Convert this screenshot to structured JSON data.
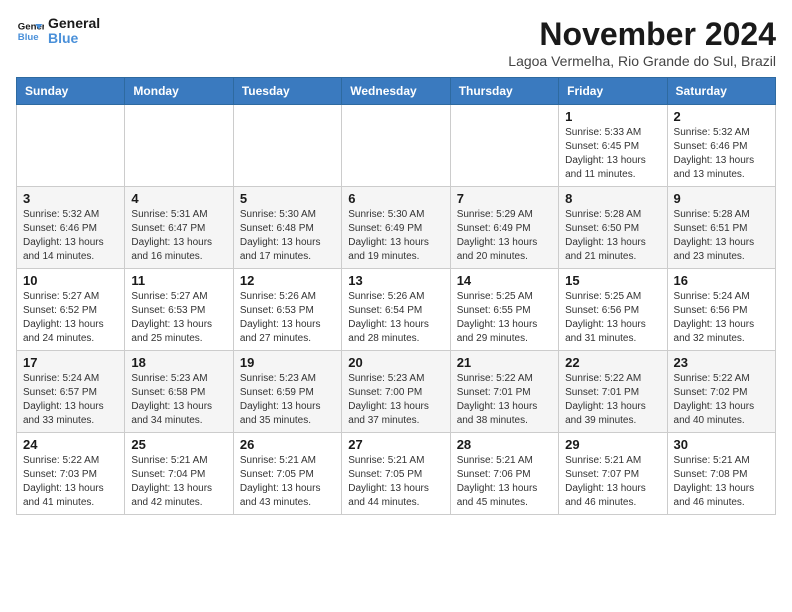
{
  "logo": {
    "line1": "General",
    "line2": "Blue"
  },
  "title": "November 2024",
  "location": "Lagoa Vermelha, Rio Grande do Sul, Brazil",
  "days_of_week": [
    "Sunday",
    "Monday",
    "Tuesday",
    "Wednesday",
    "Thursday",
    "Friday",
    "Saturday"
  ],
  "weeks": [
    [
      {
        "day": "",
        "detail": ""
      },
      {
        "day": "",
        "detail": ""
      },
      {
        "day": "",
        "detail": ""
      },
      {
        "day": "",
        "detail": ""
      },
      {
        "day": "",
        "detail": ""
      },
      {
        "day": "1",
        "detail": "Sunrise: 5:33 AM\nSunset: 6:45 PM\nDaylight: 13 hours\nand 11 minutes."
      },
      {
        "day": "2",
        "detail": "Sunrise: 5:32 AM\nSunset: 6:46 PM\nDaylight: 13 hours\nand 13 minutes."
      }
    ],
    [
      {
        "day": "3",
        "detail": "Sunrise: 5:32 AM\nSunset: 6:46 PM\nDaylight: 13 hours\nand 14 minutes."
      },
      {
        "day": "4",
        "detail": "Sunrise: 5:31 AM\nSunset: 6:47 PM\nDaylight: 13 hours\nand 16 minutes."
      },
      {
        "day": "5",
        "detail": "Sunrise: 5:30 AM\nSunset: 6:48 PM\nDaylight: 13 hours\nand 17 minutes."
      },
      {
        "day": "6",
        "detail": "Sunrise: 5:30 AM\nSunset: 6:49 PM\nDaylight: 13 hours\nand 19 minutes."
      },
      {
        "day": "7",
        "detail": "Sunrise: 5:29 AM\nSunset: 6:49 PM\nDaylight: 13 hours\nand 20 minutes."
      },
      {
        "day": "8",
        "detail": "Sunrise: 5:28 AM\nSunset: 6:50 PM\nDaylight: 13 hours\nand 21 minutes."
      },
      {
        "day": "9",
        "detail": "Sunrise: 5:28 AM\nSunset: 6:51 PM\nDaylight: 13 hours\nand 23 minutes."
      }
    ],
    [
      {
        "day": "10",
        "detail": "Sunrise: 5:27 AM\nSunset: 6:52 PM\nDaylight: 13 hours\nand 24 minutes."
      },
      {
        "day": "11",
        "detail": "Sunrise: 5:27 AM\nSunset: 6:53 PM\nDaylight: 13 hours\nand 25 minutes."
      },
      {
        "day": "12",
        "detail": "Sunrise: 5:26 AM\nSunset: 6:53 PM\nDaylight: 13 hours\nand 27 minutes."
      },
      {
        "day": "13",
        "detail": "Sunrise: 5:26 AM\nSunset: 6:54 PM\nDaylight: 13 hours\nand 28 minutes."
      },
      {
        "day": "14",
        "detail": "Sunrise: 5:25 AM\nSunset: 6:55 PM\nDaylight: 13 hours\nand 29 minutes."
      },
      {
        "day": "15",
        "detail": "Sunrise: 5:25 AM\nSunset: 6:56 PM\nDaylight: 13 hours\nand 31 minutes."
      },
      {
        "day": "16",
        "detail": "Sunrise: 5:24 AM\nSunset: 6:56 PM\nDaylight: 13 hours\nand 32 minutes."
      }
    ],
    [
      {
        "day": "17",
        "detail": "Sunrise: 5:24 AM\nSunset: 6:57 PM\nDaylight: 13 hours\nand 33 minutes."
      },
      {
        "day": "18",
        "detail": "Sunrise: 5:23 AM\nSunset: 6:58 PM\nDaylight: 13 hours\nand 34 minutes."
      },
      {
        "day": "19",
        "detail": "Sunrise: 5:23 AM\nSunset: 6:59 PM\nDaylight: 13 hours\nand 35 minutes."
      },
      {
        "day": "20",
        "detail": "Sunrise: 5:23 AM\nSunset: 7:00 PM\nDaylight: 13 hours\nand 37 minutes."
      },
      {
        "day": "21",
        "detail": "Sunrise: 5:22 AM\nSunset: 7:01 PM\nDaylight: 13 hours\nand 38 minutes."
      },
      {
        "day": "22",
        "detail": "Sunrise: 5:22 AM\nSunset: 7:01 PM\nDaylight: 13 hours\nand 39 minutes."
      },
      {
        "day": "23",
        "detail": "Sunrise: 5:22 AM\nSunset: 7:02 PM\nDaylight: 13 hours\nand 40 minutes."
      }
    ],
    [
      {
        "day": "24",
        "detail": "Sunrise: 5:22 AM\nSunset: 7:03 PM\nDaylight: 13 hours\nand 41 minutes."
      },
      {
        "day": "25",
        "detail": "Sunrise: 5:21 AM\nSunset: 7:04 PM\nDaylight: 13 hours\nand 42 minutes."
      },
      {
        "day": "26",
        "detail": "Sunrise: 5:21 AM\nSunset: 7:05 PM\nDaylight: 13 hours\nand 43 minutes."
      },
      {
        "day": "27",
        "detail": "Sunrise: 5:21 AM\nSunset: 7:05 PM\nDaylight: 13 hours\nand 44 minutes."
      },
      {
        "day": "28",
        "detail": "Sunrise: 5:21 AM\nSunset: 7:06 PM\nDaylight: 13 hours\nand 45 minutes."
      },
      {
        "day": "29",
        "detail": "Sunrise: 5:21 AM\nSunset: 7:07 PM\nDaylight: 13 hours\nand 46 minutes."
      },
      {
        "day": "30",
        "detail": "Sunrise: 5:21 AM\nSunset: 7:08 PM\nDaylight: 13 hours\nand 46 minutes."
      }
    ]
  ]
}
